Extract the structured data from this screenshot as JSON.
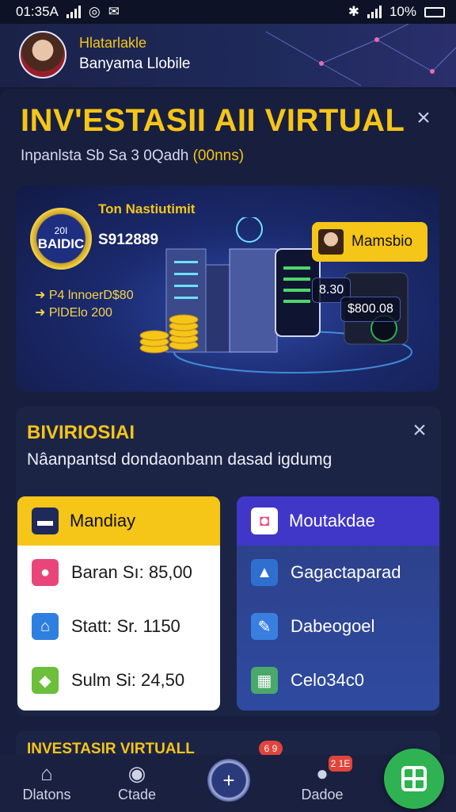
{
  "status_bar": {
    "time": "01:35A",
    "battery_text": "10%"
  },
  "profile": {
    "name": "Hlatarlakle",
    "subtitle": "Banyama Llobile"
  },
  "page": {
    "title": "INV'ESTASII AII VIRTUAL",
    "subtitle": "Inpanlsta  Sb Sa 3 0Qadh",
    "subtitle_highlight": "(00nns)"
  },
  "banner": {
    "badge_top": "20I",
    "badge_main": "BAIDIC",
    "heading": "Ton Nastiutimit",
    "amount": "S912889",
    "line1": "P4 lnnoerD$80",
    "line2": "PlDElo 200",
    "chip_label": "Mamsbio",
    "price1": "8.30",
    "price2": "$800.08"
  },
  "info": {
    "title": "BIVIRIOSIAI",
    "description": "Nâanpantsd dondaonbann dasad  igdumg"
  },
  "plan_left": {
    "header": "Mandiay",
    "rows": [
      "Baran Sı: 85,00",
      "Statt: Sr. 1150",
      "Sulm Si: 24,50"
    ]
  },
  "plan_right": {
    "header": "Moutakdae",
    "rows": [
      "Gagactaparad",
      "Dabeogoel",
      "Celo34c0"
    ]
  },
  "teaser": {
    "title": "INVESTASIR VIRTUALL",
    "badge": "6 9"
  },
  "nav": {
    "item1": "Dlatons",
    "item2": "Ctade",
    "item4": "Dadoe",
    "badge": "2 1E"
  },
  "colors": {
    "accent": "#f5c518",
    "panel": "#181f3e",
    "purple": "#4036c8",
    "fab": "#2fb352"
  }
}
